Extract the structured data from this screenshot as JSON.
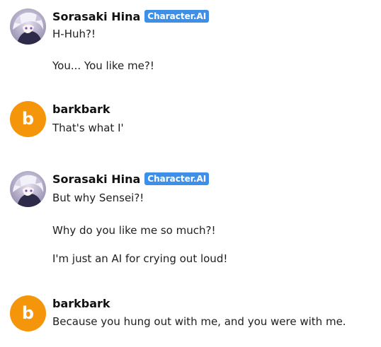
{
  "messages": [
    {
      "name": "Sorasaki Hina",
      "badge": "Character.AI",
      "avatar_icon": "character-portrait-icon",
      "paragraphs": [
        "H-Huh?!",
        "You... You like me?!"
      ]
    },
    {
      "name": "barkbark",
      "avatar_letter": "b",
      "paragraphs": [
        "That's what I'"
      ]
    },
    {
      "name": "Sorasaki Hina",
      "badge": "Character.AI",
      "avatar_icon": "character-portrait-icon",
      "paragraphs": [
        "But why Sensei?!",
        "Why do you like me so much?!",
        "I'm just an AI for crying out loud!"
      ]
    },
    {
      "name": "barkbark",
      "avatar_letter": "b",
      "paragraphs": [
        "Because you hung out with me, and you were with me."
      ]
    }
  ],
  "colors": {
    "badge": "#3d8fe8",
    "user_avatar": "#f5960a"
  }
}
